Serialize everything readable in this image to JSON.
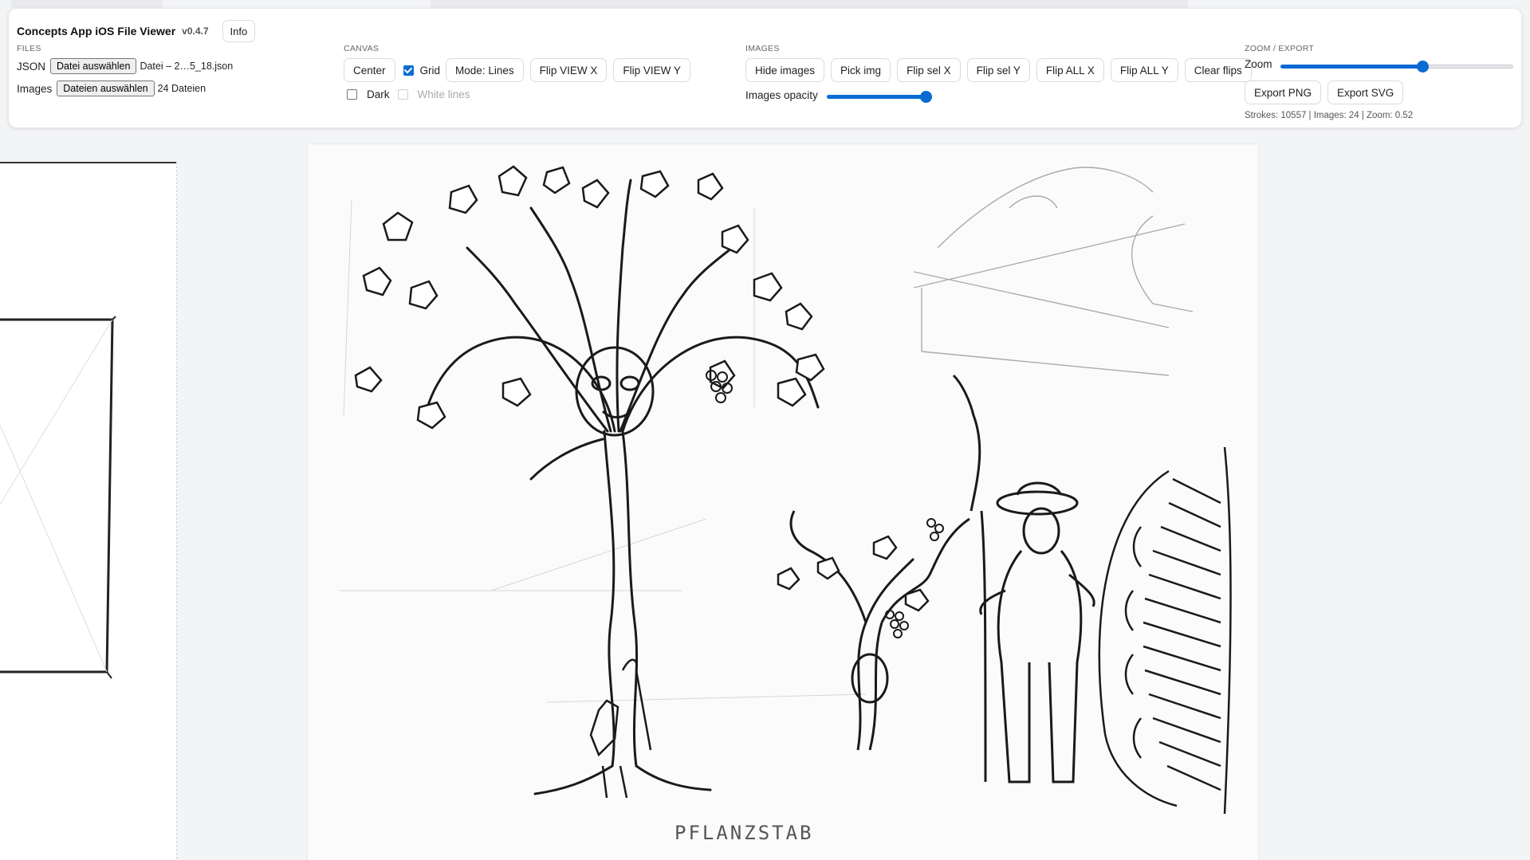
{
  "app": {
    "title": "Concepts App iOS File Viewer",
    "version": "v0.4.7",
    "info_label": "Info"
  },
  "files": {
    "section_label": "FILES",
    "json_label": "JSON",
    "json_button": "Datei auswählen",
    "json_filename": "Datei – 2…5_18.json",
    "images_label": "Images",
    "images_button": "Dateien auswählen",
    "images_count": "24 Dateien"
  },
  "canvas": {
    "section_label": "CANVAS",
    "center_label": "Center",
    "grid_label": "Grid",
    "grid_checked": true,
    "mode_label": "Mode: Lines",
    "flip_view_x": "Flip VIEW X",
    "flip_view_y": "Flip VIEW Y",
    "dark_label": "Dark",
    "dark_checked": false,
    "white_lines_label": "White lines",
    "white_lines_checked": false,
    "white_lines_disabled": true
  },
  "images": {
    "section_label": "IMAGES",
    "hide_images": "Hide images",
    "pick_img": "Pick img",
    "flip_sel_x": "Flip sel X",
    "flip_sel_y": "Flip sel Y",
    "flip_all_x": "Flip ALL X",
    "flip_all_y": "Flip ALL Y",
    "clear_flips": "Clear flips",
    "opacity_label": "Images opacity",
    "opacity_value": 0.97
  },
  "zoom_export": {
    "section_label": "ZOOM / EXPORT",
    "zoom_label": "Zoom",
    "zoom_slider_fraction": 0.61,
    "export_png": "Export PNG",
    "export_svg": "Export SVG",
    "stats": "Strokes: 10557 | Images: 24 | Zoom: 0.52"
  },
  "sketch": {
    "caption": "PFLANZSTAB"
  },
  "colors": {
    "accent": "#0b6bd3",
    "panel_bg": "#ffffff",
    "page_bg": "#f3f4f6",
    "ink": "#1a1a1a"
  }
}
